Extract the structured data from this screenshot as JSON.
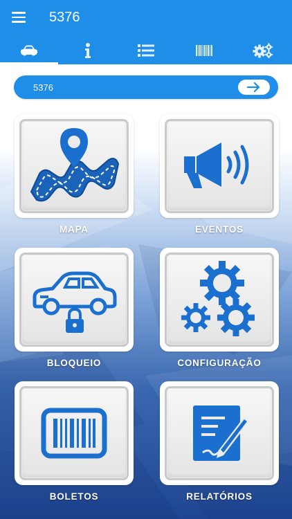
{
  "app": {
    "title": "5376"
  },
  "tabs": [
    {
      "icon": "car-icon",
      "active": true
    },
    {
      "icon": "info-icon",
      "active": false
    },
    {
      "icon": "list-icon",
      "active": false
    },
    {
      "icon": "barcode-icon",
      "active": false
    },
    {
      "icon": "gears-icon",
      "active": false
    }
  ],
  "search": {
    "value": "5376",
    "go_icon": "arrow-right-icon"
  },
  "tiles": [
    {
      "label": "MAPA",
      "icon": "map-route-icon"
    },
    {
      "label": "EVENTOS",
      "icon": "megaphone-icon"
    },
    {
      "label": "BLOQUEIO",
      "icon": "car-lock-icon"
    },
    {
      "label": "CONFIGURAÇÃO",
      "icon": "gears-icon"
    },
    {
      "label": "BOLETOS",
      "icon": "barcode-icon"
    },
    {
      "label": "RELATÓRIOS",
      "icon": "report-icon"
    }
  ],
  "colors": {
    "primary": "#1e8ee8",
    "icon_blue": "#1b6fcf",
    "tile_bg": "#ffffff"
  }
}
